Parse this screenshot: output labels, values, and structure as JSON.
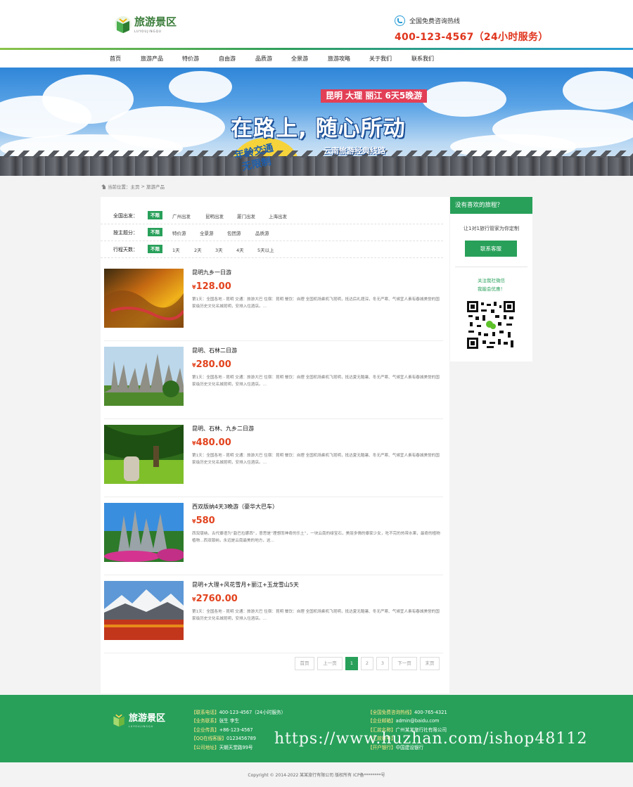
{
  "header": {
    "logo_title": "旅游景区",
    "logo_sub": "LUYOUJINGQU",
    "hotline_label": "全国免费咨询热线",
    "hotline_number": "400-123-4567（24小时服务）"
  },
  "nav": [
    "首页",
    "旅游产品",
    "特价游",
    "自由游",
    "品质游",
    "全景游",
    "旅游攻略",
    "关于我们",
    "联系我们"
  ],
  "banner": {
    "badge_line1": "年龄交通",
    "badge_line2": "无限制",
    "route": "昆明 大理 丽江 6天5晚游",
    "title_a": "在路上,",
    "title_b": "随心所动",
    "sub": "云南旅游经典线路"
  },
  "breadcrumb": {
    "label": "当前位置：",
    "home": "主页",
    "sep": ">",
    "current": "旅游产品"
  },
  "filters": [
    {
      "label": "全国出发：",
      "options": [
        "不限",
        "广州出发",
        "昆明出发",
        "厦门出发",
        "上海出发"
      ]
    },
    {
      "label": "按主题分：",
      "options": [
        "不限",
        "特价游",
        "全景游",
        "包团游",
        "品质游"
      ]
    },
    {
      "label": "行程天数：",
      "options": [
        "不限",
        "1天",
        "2天",
        "3天",
        "4天",
        "5天以上"
      ]
    }
  ],
  "products": [
    {
      "title": "昆明九乡一日游",
      "currency": "¥",
      "price": "128.00",
      "desc": "第1天：全国各地 - 昆明 交通：旅游大巴 住宿：昆明 餐饮：自理 全国机场乘机飞昆明，抵达后礼题深，冬无严寒、气候宜人素有春城美誉的国家级历史文化名城昆明，安排入住酒店。..."
    },
    {
      "title": "昆明、石林二日游",
      "currency": "¥",
      "price": "280.00",
      "desc": "第1天：全国各地 - 昆明 交通：旅游大巴 住宿：昆明 餐饮：自理 全国机场乘机飞昆明，抵达夏无酷暑、冬无严寒、气候宜人素有春城美誉的国家级历史文化名城昆明，安排入住酒店。..."
    },
    {
      "title": "昆明、石林、九乡二日游",
      "currency": "¥",
      "price": "480.00",
      "desc": "第1天：全国各地 - 昆明 交通：旅游大巴 住宿：昆明 餐饮：自理 全国机场乘机飞昆明，抵达夏无酷暑、冬无严寒、气候宜人素有春城美誉的国家级历史文化名城昆明，安排入住酒店。..."
    },
    {
      "title": "西双版纳4天3晚游（豪华大巴车）",
      "currency": "¥",
      "price": "580",
      "desc": "西双版纳，古代傣语为“勐巴拉娜西”，意思是“理想而神奇的乐土”，一块云南的绿宝石，美丽多情的傣家少女，吃不完的热带水果，最奇的植物植物...西双版纳，永远是云南最美的地方，这..."
    },
    {
      "title": "昆明+大理+风花雪月+丽江+玉龙雪山5天",
      "currency": "¥",
      "price": "2760.00",
      "desc": "第1天：全国各地 - 昆明 交通：旅游大巴 住宿：昆明 餐饮：自理 全国机场乘机飞昆明，抵达夏无酷暑、冬无严寒、气候宜人素有春城美誉的国家级历史文化名城昆明，安排入住酒店。..."
    }
  ],
  "pager": [
    "首页",
    "上一页",
    "1",
    "2",
    "3",
    "下一页",
    "末页"
  ],
  "sidebar": {
    "title": "没有喜欢的旅程？",
    "text": "让1对1旅行管家为你定制",
    "button": "联系客服",
    "wx_line1": "关注我社微信",
    "wx_line2": "我能会优惠！"
  },
  "footer": {
    "logo_title": "旅游景区",
    "logo_sub": "LUYOUJINGQU",
    "col1": [
      {
        "label": "【联系电话】",
        "value": "400-123-4567（24小时服务）"
      },
      {
        "label": "【业务联系】",
        "value": "张生 李生"
      },
      {
        "label": "【企业传真】",
        "value": "+86-123-4567"
      },
      {
        "label": "【QQ在线客服】",
        "value": "0123456789"
      },
      {
        "label": "【公司地址】",
        "value": "天朝天堂路99号"
      }
    ],
    "col2": [
      {
        "label": "【全国免费咨询热线】",
        "value": "400-765-4321"
      },
      {
        "label": "【企业邮箱】",
        "value": "admin@baidu.com"
      },
      {
        "label": "【汇款名称】",
        "value": "广州某某旅行社有限公司"
      },
      {
        "label": "【汇款账号】",
        "value": ""
      },
      {
        "label": "【开户银行】",
        "value": "中国建设银行"
      }
    ],
    "watermark": "https://www.huzhan.com/ishop48112",
    "copyright": "Copyright © 2014-2022 某某旅行有限公司 版权所有    ICP备********号"
  },
  "colors": {
    "brand_green": "#28a05a",
    "price_red": "#e2431e",
    "hotline_red": "#e0351d"
  }
}
